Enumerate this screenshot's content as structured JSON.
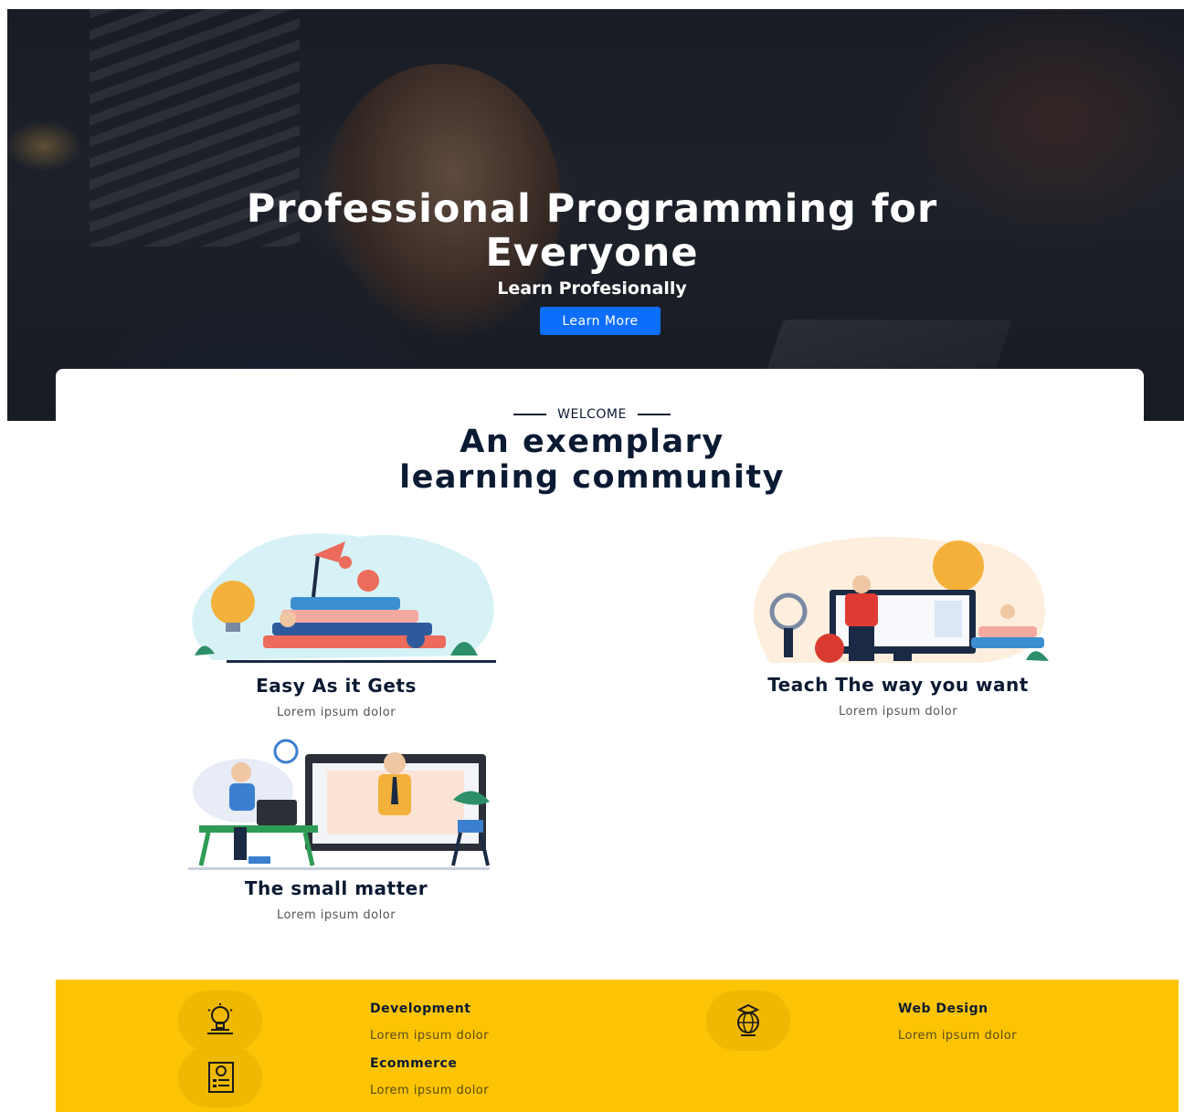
{
  "hero": {
    "title_line1": "Professional Programming for",
    "title_line2": "Everyone",
    "subtitle": "Learn Profesionally",
    "button_label": "Learn More",
    "button_color": "#0d6efd"
  },
  "welcome": {
    "eyebrow": "WELCOME",
    "title_line1": "An exemplary",
    "title_line2": "learning community"
  },
  "features": [
    {
      "title": "Easy As it Gets",
      "description": "Lorem ipsum dolor",
      "icon": "books-learning-illustration"
    },
    {
      "title": "Teach The way you want",
      "description": "Lorem ipsum dolor",
      "icon": "teacher-screen-illustration"
    },
    {
      "title": "The small matter",
      "description": "Lorem ipsum dolor",
      "icon": "online-class-illustration"
    }
  ],
  "services": {
    "background_color": "#fcc404",
    "items": [
      {
        "title": "Development",
        "description": "Lorem ipsum dolor",
        "icon": "lightbulb-icon"
      },
      {
        "title": "Web Design",
        "description": "Lorem ipsum dolor",
        "icon": "globe-graduation-icon"
      },
      {
        "title": "Ecommerce",
        "description": "Lorem ipsum dolor",
        "icon": "document-list-icon"
      }
    ]
  },
  "colors": {
    "navy": "#0b1a33",
    "accent_blue": "#0d6efd",
    "yellow": "#fcc404"
  }
}
